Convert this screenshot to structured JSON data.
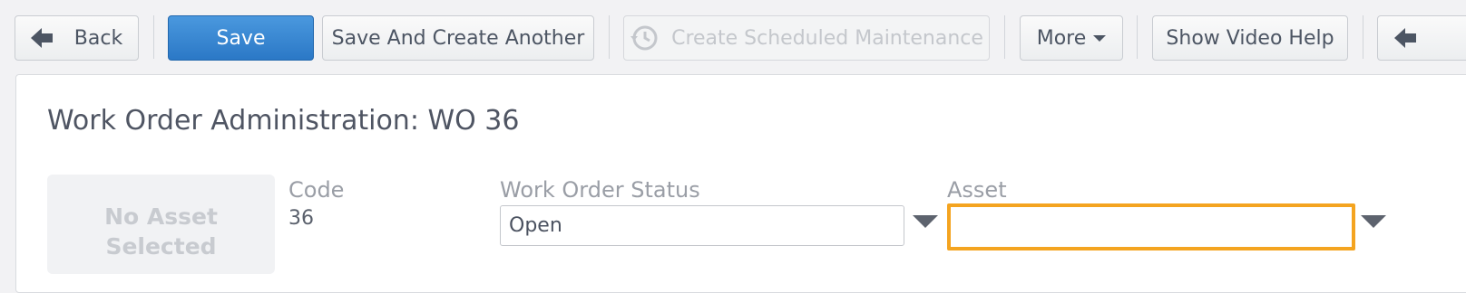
{
  "toolbar": {
    "back_label": "Back",
    "save_label": "Save",
    "save_create_another_label": "Save And Create Another",
    "create_scheduled_label": "Create Scheduled Maintenance",
    "more_label": "More",
    "show_video_help_label": "Show Video Help"
  },
  "page": {
    "title": "Work Order Administration: WO 36"
  },
  "asset_panel": {
    "no_asset_text": "No Asset Selected"
  },
  "fields": {
    "code": {
      "label": "Code",
      "value": "36"
    },
    "status": {
      "label": "Work Order Status",
      "value": "Open"
    },
    "asset": {
      "label": "Asset",
      "value": ""
    }
  },
  "colors": {
    "primary": "#2b78c6",
    "focus": "#f4a420"
  }
}
